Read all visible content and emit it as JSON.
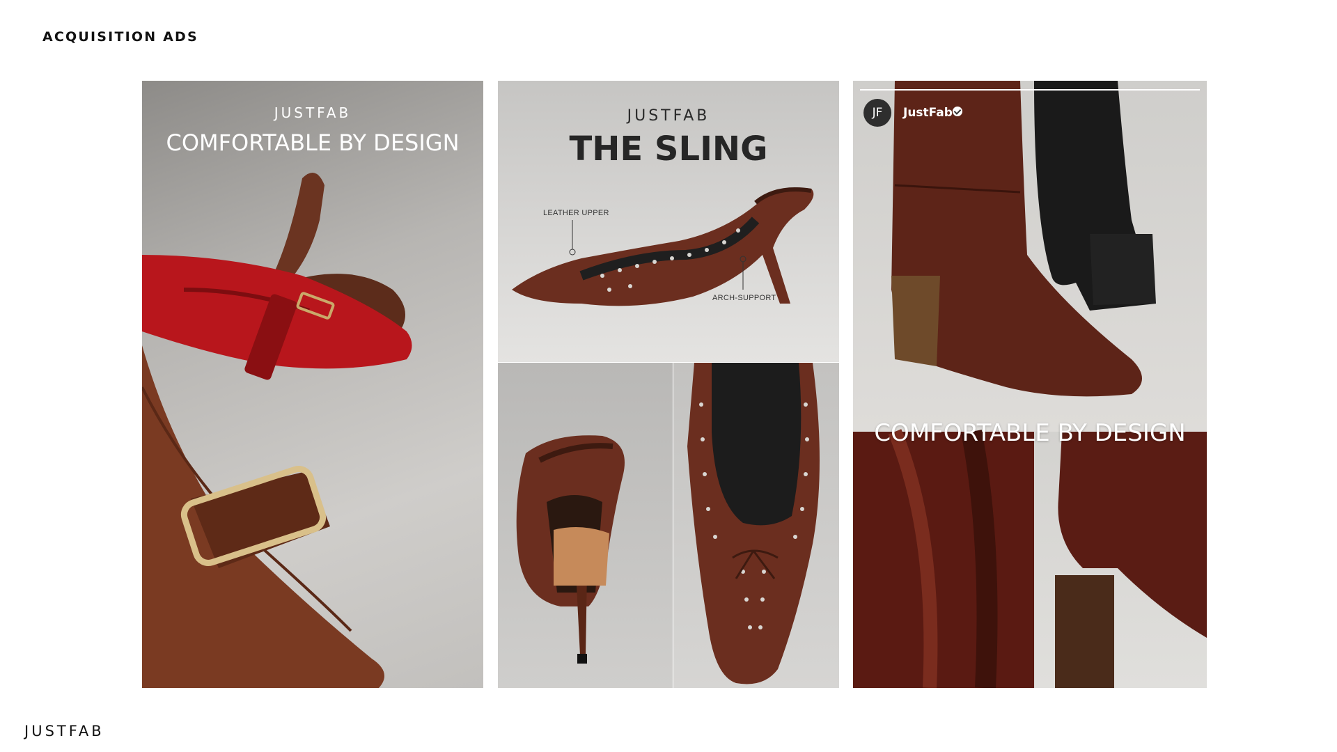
{
  "page": {
    "title": "ACQUISITION ADS",
    "footer_brand": "JUSTFAB"
  },
  "ads": [
    {
      "brand": "JUSTFAB",
      "headline": "COMFORTABLE BY DESIGN",
      "image": "footwear-flatlay-photo"
    },
    {
      "brand": "JUSTFAB",
      "headline": "THE SLING",
      "callouts": [
        "LEATHER UPPER",
        "ARCH-SUPPORT"
      ],
      "image": "slingback-heel-photo"
    },
    {
      "image": "slingback-heel-back-photo"
    },
    {
      "image": "slingback-toe-closeup-photo"
    },
    {
      "avatar": "JF",
      "handle": "JustFab",
      "headline": "COMFORTABLE BY DESIGN",
      "image": "brown-boots-collage-photo"
    }
  ],
  "colors": {
    "leather_brown": "#6b2e1f",
    "red_patent": "#b8161c",
    "black": "#1a1a1a"
  }
}
